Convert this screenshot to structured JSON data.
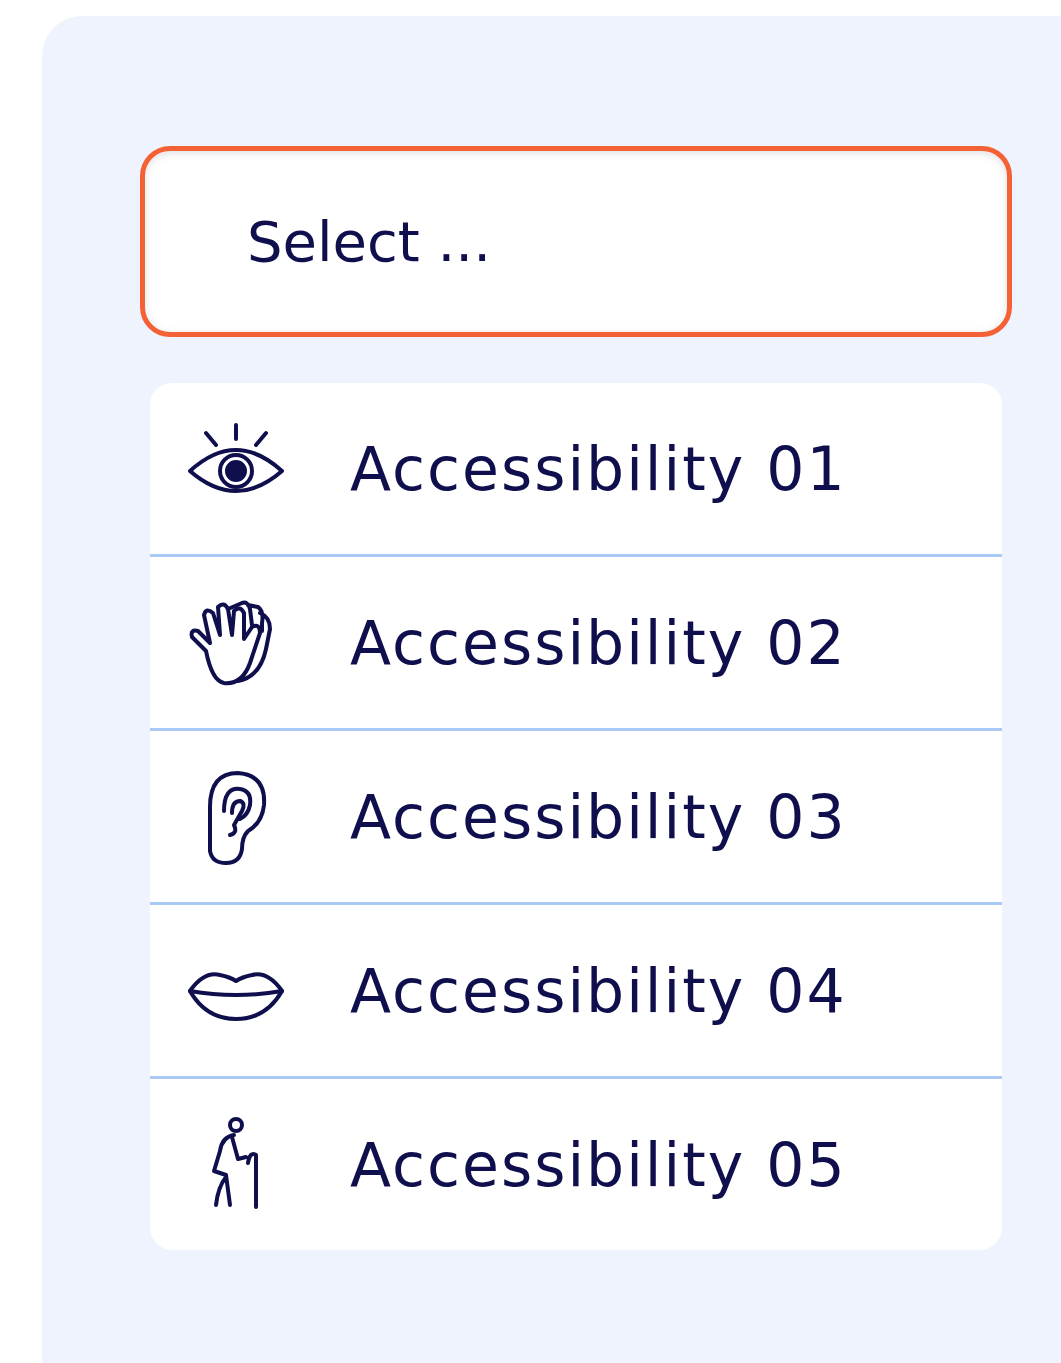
{
  "select": {
    "placeholder": "Select ...",
    "focused": true
  },
  "options": [
    {
      "label": "Accessibility 01",
      "kind": "eye"
    },
    {
      "label": "Accessibility 02",
      "kind": "hand"
    },
    {
      "label": "Accessibility 03",
      "kind": "ear"
    },
    {
      "label": "Accessibility 04",
      "kind": "lips"
    },
    {
      "label": "Accessibility 05",
      "kind": "walker"
    }
  ]
}
